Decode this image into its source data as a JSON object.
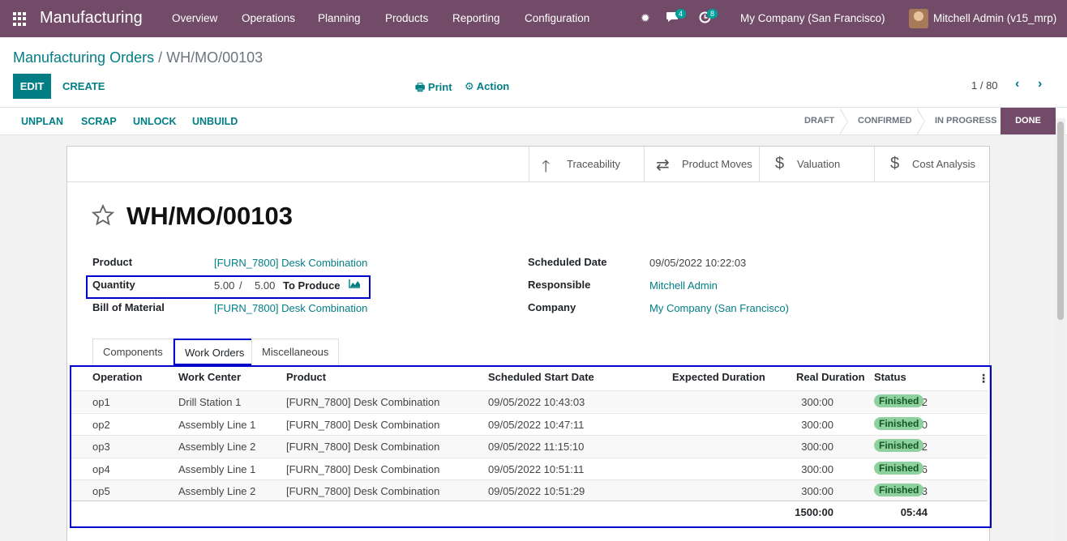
{
  "navbar": {
    "app_name": "Manufacturing",
    "menu": [
      "Overview",
      "Operations",
      "Planning",
      "Products",
      "Reporting",
      "Configuration"
    ],
    "messages_count": "4",
    "activities_count": "8",
    "company": "My Company (San Francisco)",
    "user": "Mitchell Admin (v15_mrp)"
  },
  "breadcrumb": {
    "parent": "Manufacturing Orders",
    "separator": "/",
    "current": "WH/MO/00103"
  },
  "toolbar": {
    "edit": "EDIT",
    "create": "CREATE",
    "print": "Print",
    "action": "Action",
    "pager": "1 / 80"
  },
  "statusbar": {
    "buttons": [
      "UNPLAN",
      "SCRAP",
      "UNLOCK",
      "UNBUILD"
    ],
    "stages": [
      "DRAFT",
      "CONFIRMED",
      "IN PROGRESS",
      "DONE"
    ],
    "active_stage": "DONE"
  },
  "smart_buttons": [
    {
      "label": "Traceability",
      "icon": "arrow-up-icon"
    },
    {
      "label": "Product Moves",
      "icon": "exchange-icon"
    },
    {
      "label": "Valuation",
      "icon": "dollar-icon"
    },
    {
      "label": "Cost Analysis",
      "icon": "dollar-icon"
    }
  ],
  "record": {
    "name": "WH/MO/00103",
    "product_label": "Product",
    "product": "[FURN_7800] Desk Combination",
    "quantity_label": "Quantity",
    "qty_produced": "5.00",
    "qty_sep": "/",
    "qty_total": "5.00",
    "qty_suffix": "To Produce",
    "bom_label": "Bill of Material",
    "bom": "[FURN_7800] Desk Combination",
    "scheduled_label": "Scheduled Date",
    "scheduled": "09/05/2022 10:22:03",
    "responsible_label": "Responsible",
    "responsible": "Mitchell Admin",
    "company_label": "Company",
    "company": "My Company (San Francisco)"
  },
  "tabs": [
    "Components",
    "Work Orders",
    "Miscellaneous"
  ],
  "active_tab": "Work Orders",
  "work_orders": {
    "columns": [
      "Operation",
      "Work Center",
      "Product",
      "Scheduled Start Date",
      "Expected Duration",
      "Real Duration",
      "Status"
    ],
    "rows": [
      [
        "op1",
        "Drill Station 1",
        "[FURN_7800] Desk Combination",
        "09/05/2022 10:43:03",
        "300:00",
        "04:02",
        "Finished"
      ],
      [
        "op2",
        "Assembly Line 1",
        "[FURN_7800] Desk Combination",
        "09/05/2022 10:47:11",
        "300:00",
        "00:50",
        "Finished"
      ],
      [
        "op3",
        "Assembly Line 2",
        "[FURN_7800] Desk Combination",
        "09/05/2022 11:15:10",
        "300:00",
        "00:02",
        "Finished"
      ],
      [
        "op4",
        "Assembly Line 1",
        "[FURN_7800] Desk Combination",
        "09/05/2022 10:51:11",
        "300:00",
        "00:26",
        "Finished"
      ],
      [
        "op5",
        "Assembly Line 2",
        "[FURN_7800] Desk Combination",
        "09/05/2022 10:51:29",
        "300:00",
        "00:23",
        "Finished"
      ]
    ],
    "total_expected": "1500:00",
    "total_real": "05:44"
  },
  "colors": {
    "brand": "#714b67",
    "link": "#017e84",
    "highlight": "#0000cc",
    "finished": "#8fd19e"
  }
}
